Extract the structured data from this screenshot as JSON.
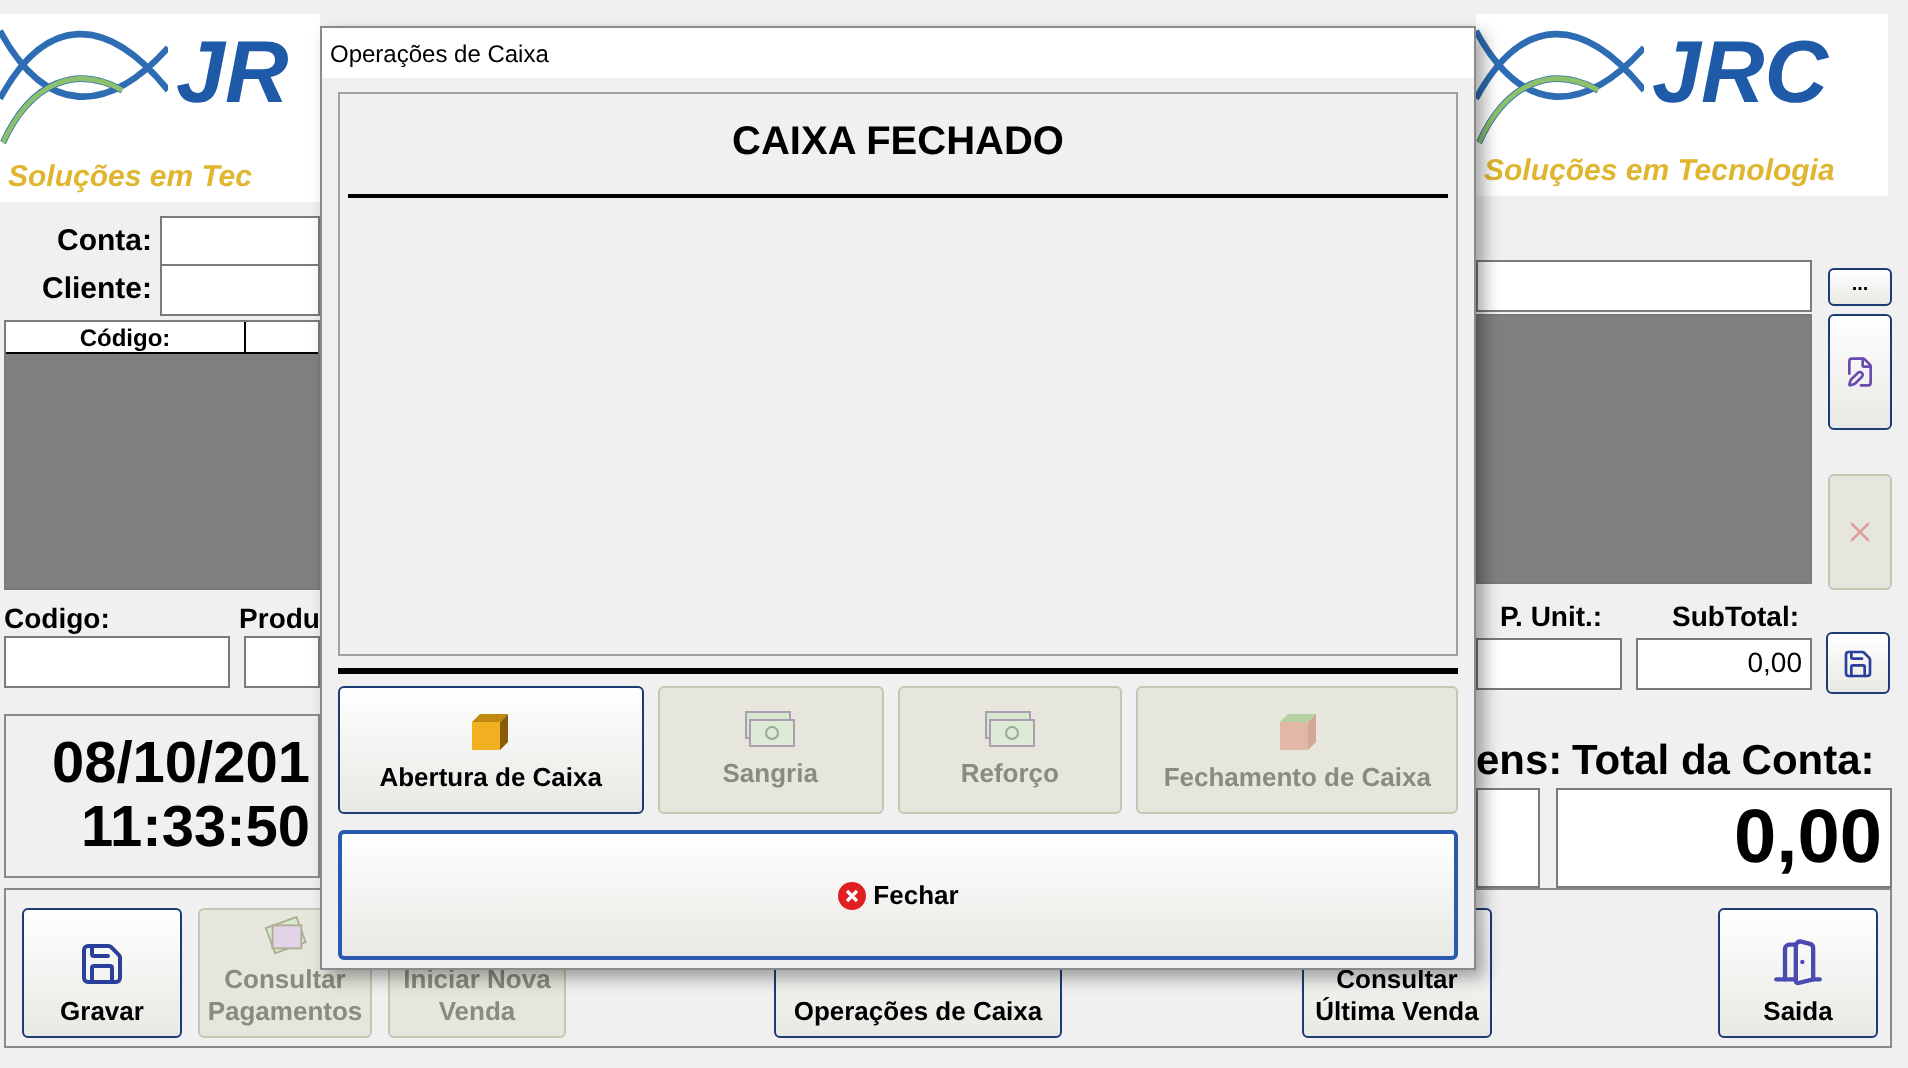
{
  "logo_left": {
    "letters": "JR",
    "tagline": "Soluções em Tec"
  },
  "logo_right": {
    "letters": "JRC",
    "tagline": "Soluções em Tecnologia"
  },
  "account": {
    "label": "Conta:"
  },
  "client": {
    "label": "Cliente:",
    "button": "..."
  },
  "items_table": {
    "columns": [
      "Código:"
    ]
  },
  "side_buttons": [
    {
      "kind": "edit",
      "disabled": false
    },
    {
      "kind": "delete",
      "disabled": true
    }
  ],
  "entry": {
    "code_label": "Codigo:",
    "product_label": "Produ",
    "unit_price_label": "P. Unit.:",
    "subtotal_label": "SubTotal:",
    "subtotal_value": "0,00"
  },
  "clock": {
    "date": "08/10/201",
    "time": "11:33:50"
  },
  "totals": {
    "items_label": "ens:",
    "total_label": "Total da Conta:",
    "total_value": "0,00"
  },
  "bottom_buttons": [
    {
      "kind": "save",
      "label": "Gravar",
      "disabled": false
    },
    {
      "kind": "payments",
      "label": "Consultar Pagamentos",
      "disabled": true
    },
    {
      "kind": "new",
      "label": "Iniciar Nova Venda",
      "disabled": true
    },
    {
      "kind": "cash",
      "label": "Operações de Caixa",
      "disabled": false
    },
    {
      "kind": "last",
      "label": "Consultar Última Venda",
      "disabled": false
    },
    {
      "kind": "exit",
      "label": "Saida",
      "disabled": false
    }
  ],
  "dialog": {
    "title": "Operações de Caixa",
    "status": "CAIXA FECHADO",
    "actions": [
      {
        "kind": "open",
        "label": "Abertura de Caixa",
        "disabled": false
      },
      {
        "kind": "withdraw",
        "label": "Sangria",
        "disabled": true
      },
      {
        "kind": "deposit",
        "label": "Reforço",
        "disabled": true
      },
      {
        "kind": "close",
        "label": "Fechamento de Caixa",
        "disabled": true
      }
    ],
    "close_button": "Fechar"
  }
}
